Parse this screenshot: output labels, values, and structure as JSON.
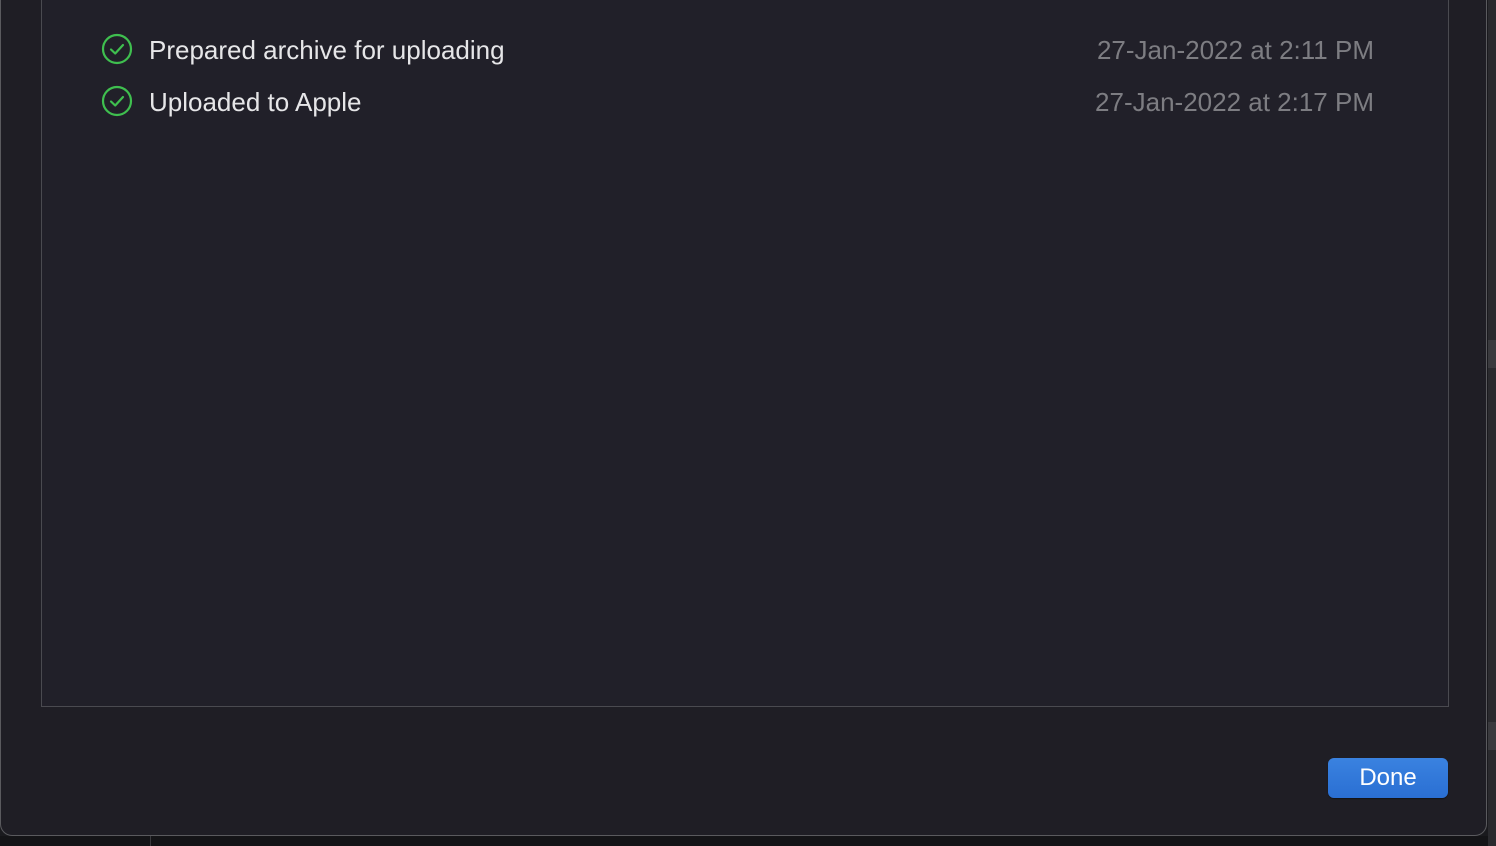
{
  "log": {
    "entries": [
      {
        "status_icon": "checkmark-circle-icon",
        "label": "Prepared archive for uploading",
        "timestamp": "27-Jan-2022 at 2:11 PM"
      },
      {
        "status_icon": "checkmark-circle-icon",
        "label": "Uploaded to Apple",
        "timestamp": "27-Jan-2022 at 2:17 PM"
      }
    ]
  },
  "footer": {
    "done_label": "Done"
  },
  "colors": {
    "success_green": "#3fbf4f",
    "accent_blue": "#2f76d9"
  }
}
